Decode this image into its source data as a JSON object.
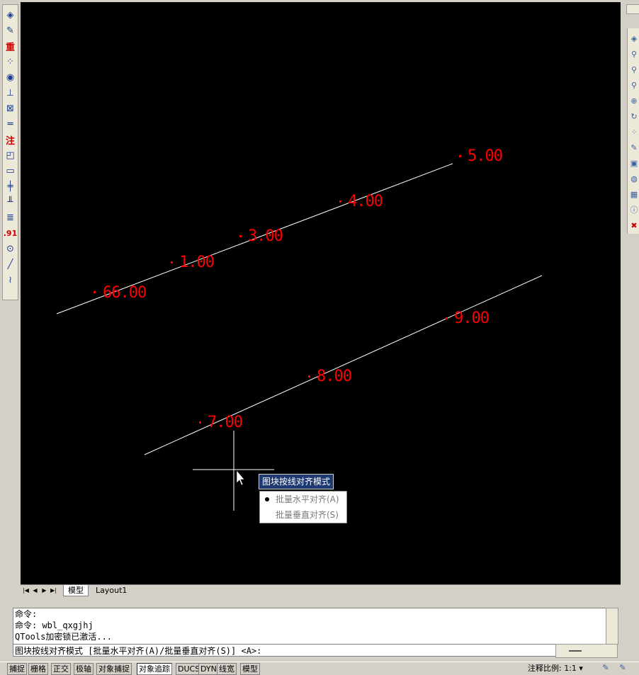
{
  "left_toolbar": [
    {
      "icon": "layer-tool-icon"
    },
    {
      "icon": "edit-tool-icon"
    },
    {
      "icon": "text-zhong-icon",
      "glyph": "重"
    },
    {
      "icon": "grid-snap-icon"
    },
    {
      "icon": "camera-icon"
    },
    {
      "icon": "dimension-icon"
    },
    {
      "icon": "measure-icon"
    },
    {
      "icon": "ruler-icon"
    },
    {
      "icon": "text-zhu-icon",
      "glyph": "注"
    },
    {
      "icon": "rectangle-corner-icon"
    },
    {
      "icon": "rectangle-icon"
    },
    {
      "icon": "bar-icon"
    },
    {
      "icon": "comb-icon"
    },
    {
      "icon": "table-icon"
    },
    {
      "icon": "decimal-icon",
      "glyph": ".91"
    },
    {
      "icon": "circle-target-icon"
    },
    {
      "icon": "line-icon"
    },
    {
      "icon": "wave-icon"
    }
  ],
  "right_toolbar": [
    "layers-icon",
    "zoom-icon",
    "zoom-window-icon",
    "zoom-prev-icon",
    "zoom-in-icon",
    "orbit-icon",
    "dots-grid-icon",
    "properties-icon",
    "block-icon",
    "object-icon",
    "matrix-icon",
    "info-icon",
    "delete-icon"
  ],
  "drawing": {
    "labels_top": [
      "66.00",
      "1.00",
      "3.00",
      "4.00",
      "5.00"
    ],
    "labels_bottom": [
      "7.00",
      "8.00",
      "9.00"
    ],
    "label_color": "#ff0000",
    "line_color": "#ffffff"
  },
  "tooltip": "图块按线对齐模式",
  "menu": {
    "items": [
      "批量水平对齐(A)",
      "批量垂直对齐(S)"
    ],
    "selected": 0
  },
  "tabs": {
    "model": "模型",
    "layout": "Layout1"
  },
  "command_history": [
    "命令:",
    "命令: wbl_qxgjhj",
    "QTools加密锁已激活..."
  ],
  "command_prompt": "图块按线对齐模式 [批量水平对齐(A)/批量垂直对齐(S)] <A>:",
  "status_bar": {
    "buttons": [
      "捕捉",
      "栅格",
      "正交",
      "极轴",
      "对象捕捉",
      "对象追踪",
      "DUCS",
      "DYN",
      "线宽",
      "模型"
    ],
    "active": [
      "对象追踪"
    ],
    "annotation_scale_label": "注释比例:",
    "annotation_scale_value": "1:1"
  }
}
